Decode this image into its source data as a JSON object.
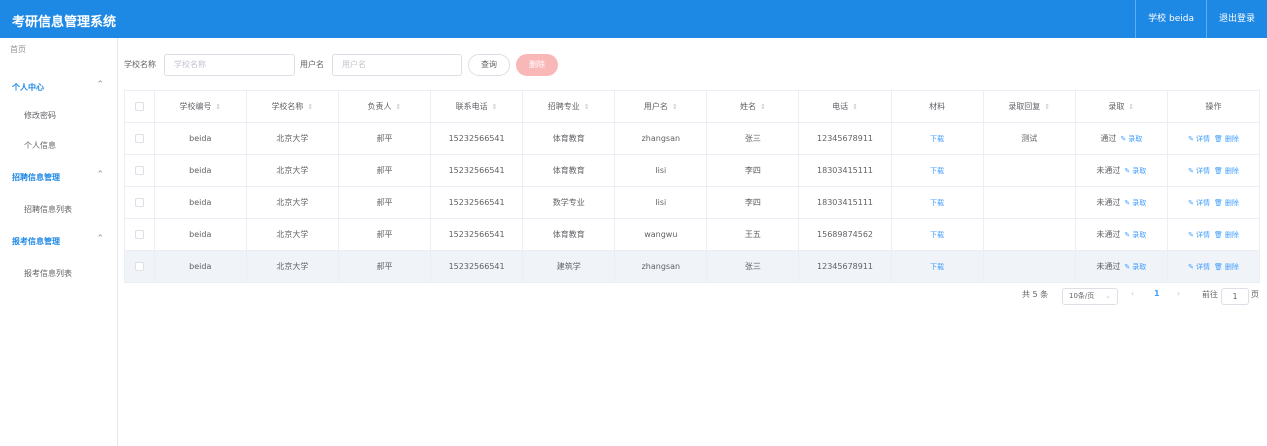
{
  "header": {
    "title": "考研信息管理系统",
    "user": "学校 beida",
    "logout": "退出登录"
  },
  "sidebar": {
    "home": "首页",
    "groups": [
      {
        "label": "个人中心",
        "items": [
          "修改密码",
          "个人信息"
        ]
      },
      {
        "label": "招聘信息管理",
        "items": [
          "招聘信息列表"
        ]
      },
      {
        "label": "报考信息管理",
        "items": [
          "报考信息列表"
        ]
      }
    ]
  },
  "search": {
    "school_label": "学校名称",
    "school_placeholder": "学校名称",
    "user_label": "用户名",
    "user_placeholder": "用户名",
    "query_button": "查询",
    "delete_button": "删除"
  },
  "table": {
    "columns": [
      "学校编号",
      "学校名称",
      "负责人",
      "联系电话",
      "招聘专业",
      "用户名",
      "姓名",
      "电话",
      "材料",
      "录取回复",
      "录取",
      "操作"
    ],
    "rows": [
      [
        "beida",
        "北京大学",
        "郝平",
        "15232566541",
        "体育教育",
        "zhangsan",
        "张三",
        "12345678911",
        "下载",
        "测试",
        "通过"
      ],
      [
        "beida",
        "北京大学",
        "郝平",
        "15232566541",
        "体育教育",
        "lisi",
        "李四",
        "18303415111",
        "下载",
        "",
        "未通过"
      ],
      [
        "beida",
        "北京大学",
        "郝平",
        "15232566541",
        "数学专业",
        "lisi",
        "李四",
        "18303415111",
        "下载",
        "",
        "未通过"
      ],
      [
        "beida",
        "北京大学",
        "郝平",
        "15232566541",
        "体育教育",
        "wangwu",
        "王五",
        "15689874562",
        "下载",
        "",
        "未通过"
      ],
      [
        "beida",
        "北京大学",
        "郝平",
        "15232566541",
        "建筑学",
        "zhangsan",
        "张三",
        "12345678911",
        "下载",
        "",
        "未通过"
      ]
    ],
    "admit_action": "录取",
    "detail_action": "详情",
    "delete_action": "删除"
  },
  "pagination": {
    "total": "共 5 条",
    "page_size": "10条/页",
    "current_page": "1",
    "goto_label": "前往",
    "goto_value": "1",
    "page_unit": "页"
  }
}
